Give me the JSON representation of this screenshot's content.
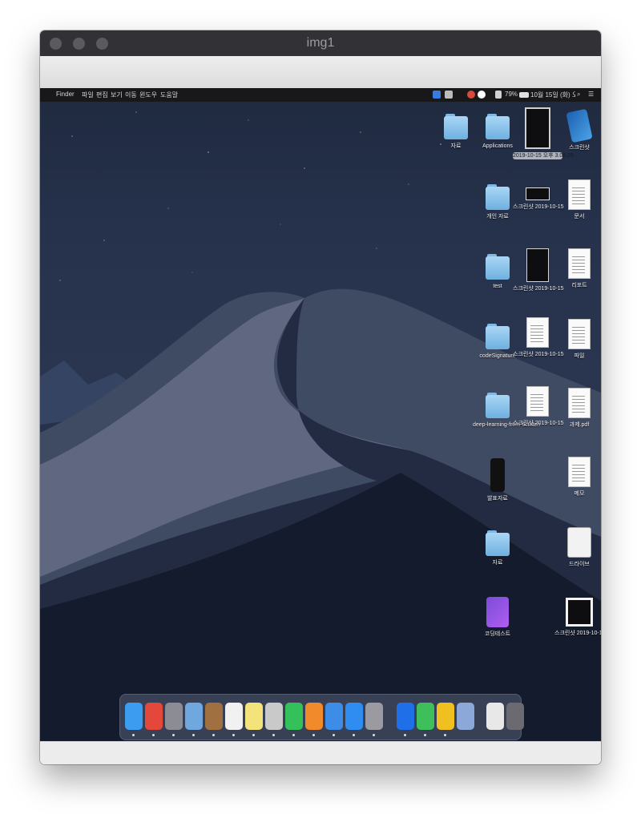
{
  "window": {
    "title": "img1"
  },
  "menubar": {
    "apple_glyph": "",
    "menus": [
      "Finder",
      "파일",
      "편집",
      "보기",
      "이동",
      "윈도우",
      "도움말"
    ],
    "battery": "79%",
    "clock": "10월 15일 (화) 오후 3:11",
    "status_icons": [
      "bluetooth-icon",
      "security-icon",
      "wifi-icon",
      "battery-icon",
      "search-icon",
      "control-center-icon"
    ]
  },
  "desktop": {
    "wallpaper": "macOS Mojave dark",
    "icons": [
      {
        "label": "자료",
        "kind": "folder"
      },
      {
        "label": "Applications",
        "kind": "folder"
      },
      {
        "label": "스크린샷 2019-10-15",
        "kind": "screenshot"
      },
      {
        "label": "스크린샷",
        "kind": "app"
      },
      {
        "label": "개인 자료",
        "kind": "folder"
      },
      {
        "label": "스크린샷 2019-10-15",
        "kind": "screenshot"
      },
      {
        "label": "문서",
        "kind": "doc"
      },
      {
        "label": "test",
        "kind": "folder"
      },
      {
        "label": "스크린샷 2019-10-15",
        "kind": "screenshot"
      },
      {
        "label": "리포트",
        "kind": "doc"
      },
      {
        "label": "codeSignature",
        "kind": "folder"
      },
      {
        "label": "스크린샷 2019-10-15",
        "kind": "screenshot"
      },
      {
        "label": "파일",
        "kind": "doc"
      },
      {
        "label": "deep-learning-from-scratch",
        "kind": "folder"
      },
      {
        "label": "스크린샷 2019-10-15",
        "kind": "screenshot"
      },
      {
        "label": "과제.pdf",
        "kind": "doc"
      },
      {
        "label": "발표자료",
        "kind": "app"
      },
      {
        "label": "메모",
        "kind": "doc"
      },
      {
        "label": "자료",
        "kind": "folder"
      },
      {
        "label": "드라이브",
        "kind": "app"
      },
      {
        "label": "코딩테스트",
        "kind": "app"
      },
      {
        "label": "스크린샷 2019-10-15",
        "kind": "screenshot"
      }
    ],
    "tooltip": "2019-10-15 오후 3.08.25"
  },
  "dock": {
    "apps": [
      {
        "name": "finder-icon",
        "color": "#3b9cf0"
      },
      {
        "name": "chrome-icon",
        "color": "#e3483a"
      },
      {
        "name": "launchpad-icon",
        "color": "#8c8c94"
      },
      {
        "name": "preview-icon",
        "color": "#6fa7df"
      },
      {
        "name": "notes-book-icon",
        "color": "#a07040"
      },
      {
        "name": "calendar-icon",
        "color": "#f1f1f1"
      },
      {
        "name": "notes-icon",
        "color": "#f4e27a"
      },
      {
        "name": "photos-icon",
        "color": "#c9c9c9"
      },
      {
        "name": "facetime-icon",
        "color": "#34c15a"
      },
      {
        "name": "books-icon",
        "color": "#f08a2b"
      },
      {
        "name": "keynote-icon",
        "color": "#3d8de8"
      },
      {
        "name": "app-store-icon",
        "color": "#2f8cf0"
      },
      {
        "name": "system-preferences-icon",
        "color": "#9a9aa0"
      },
      {
        "name": "teamviewer-icon",
        "color": "#1f6fe8"
      },
      {
        "name": "pycharm-icon",
        "color": "#3ebf5c"
      },
      {
        "name": "sublime-icon",
        "color": "#f0c020"
      },
      {
        "name": "image-capture-icon",
        "color": "#8ca8d8"
      },
      {
        "name": "contact-photo-icon",
        "color": "#e8e8e8"
      },
      {
        "name": "trash-icon",
        "color": "#6a6a70"
      }
    ]
  }
}
